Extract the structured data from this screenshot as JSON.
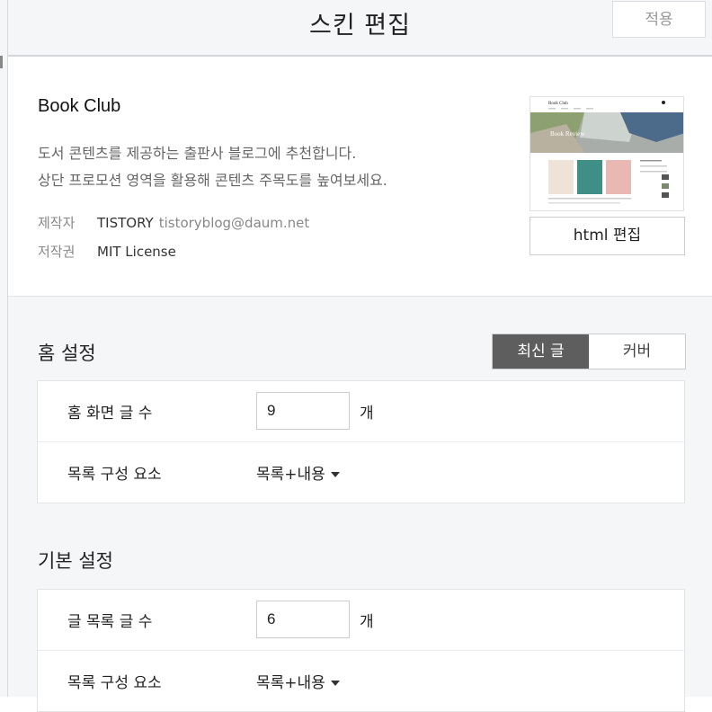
{
  "header": {
    "title": "스킨 편집",
    "apply_label": "적용"
  },
  "skin": {
    "name": "Book Club",
    "description_line1": "도서 콘텐츠를 제공하는 출판사 블로그에 추천합니다.",
    "description_line2": "상단 프로모션 영역을 활용해 콘텐츠 주목도를 높여보세요.",
    "author_key": "제작자",
    "author_name": "TISTORY",
    "author_email": "tistoryblog@daum.net",
    "license_key": "저작권",
    "license_value": "MIT License",
    "preview_logo": "Book Club",
    "preview_banner": "Book Review",
    "html_edit_label": "html 편집"
  },
  "home_settings": {
    "title": "홈 설정",
    "toggle_latest": "최신 글",
    "toggle_cover": "커버",
    "post_count_label": "홈 화면 글 수",
    "post_count_value": "9",
    "post_count_unit": "개",
    "list_config_label": "목록 구성 요소",
    "list_config_value": "목록+내용"
  },
  "basic_settings": {
    "title": "기본 설정",
    "post_count_label": "글 목록 글 수",
    "post_count_value": "6",
    "post_count_unit": "개",
    "list_config_label": "목록 구성 요소",
    "list_config_value": "목록+내용"
  },
  "colors": {
    "toggle_active": "#5e5e5e",
    "header_bg": "#f5f6f8",
    "settings_bg": "#f5f6f8"
  }
}
